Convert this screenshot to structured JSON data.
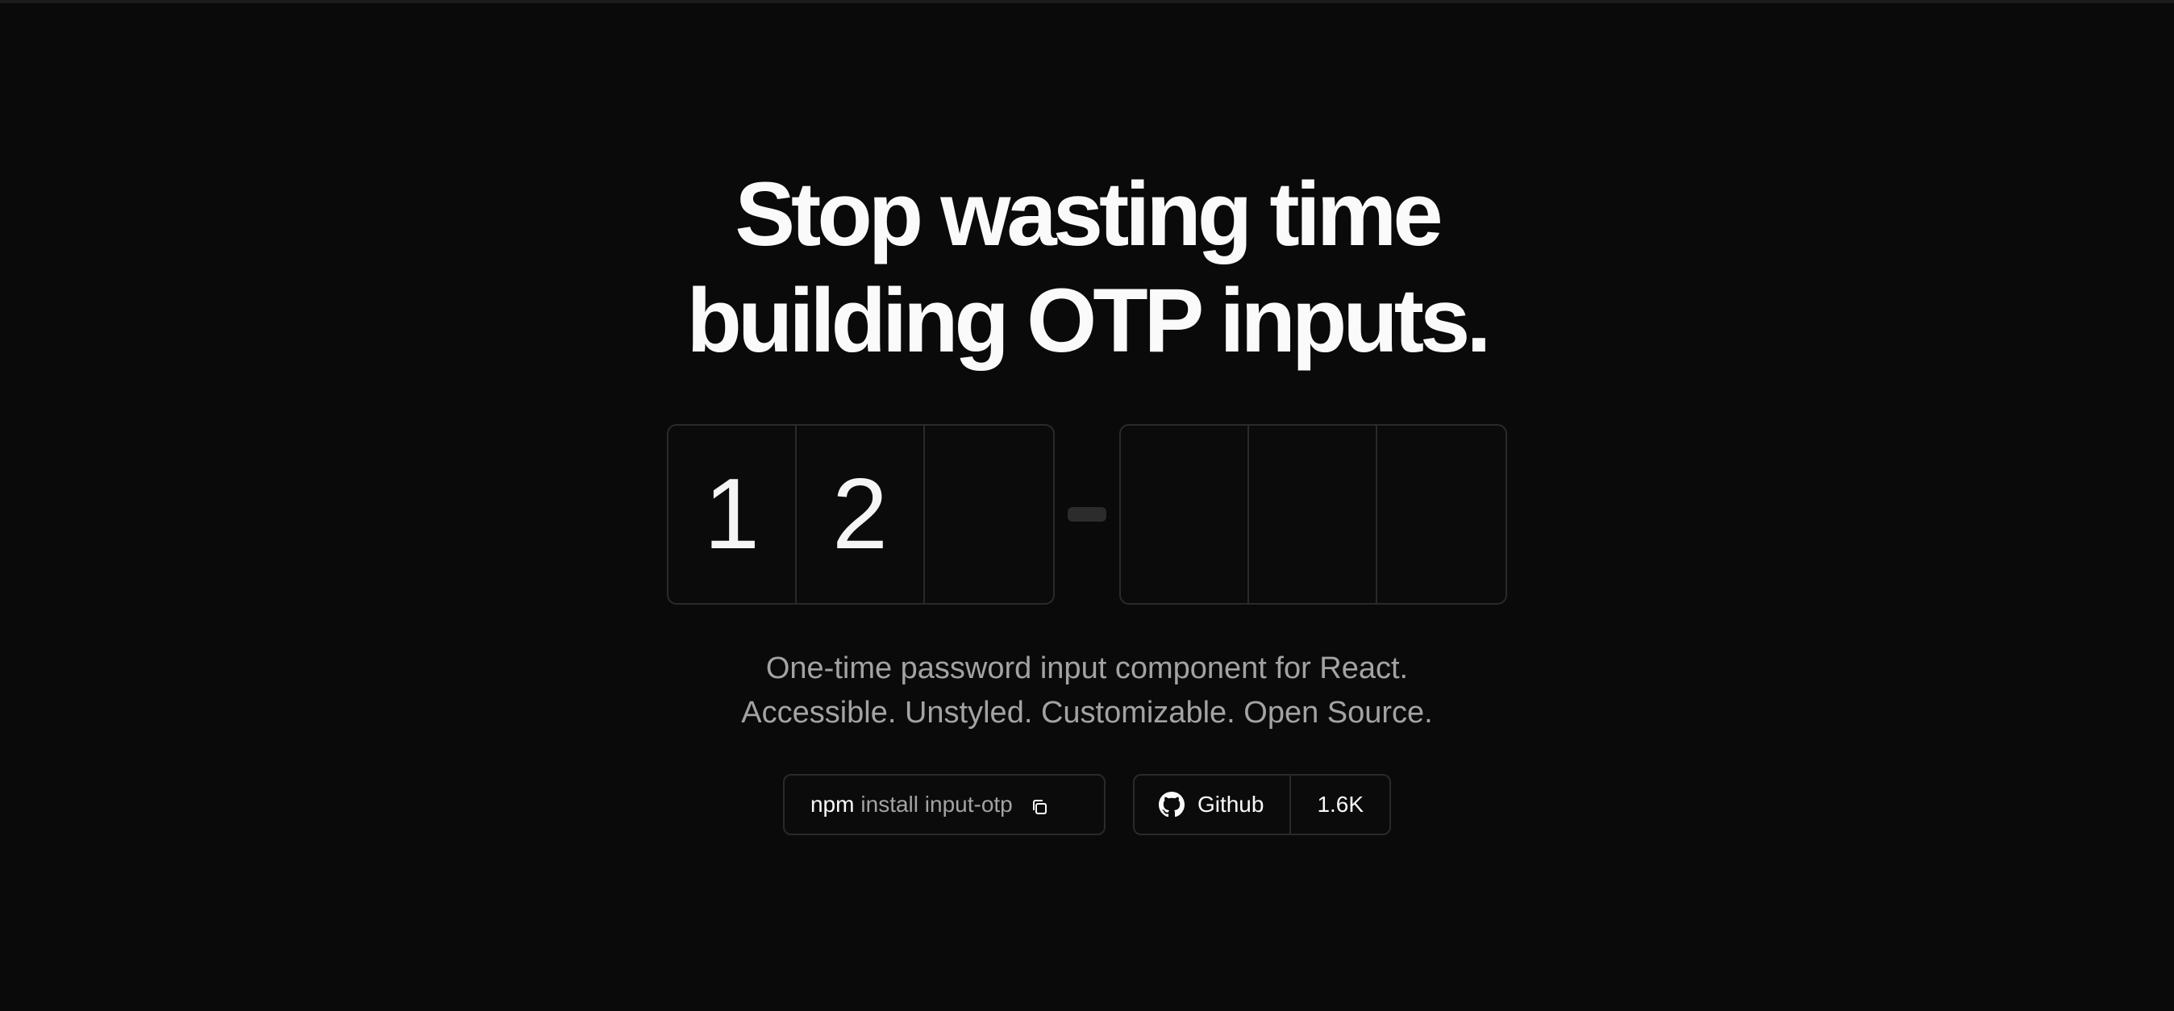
{
  "hero": {
    "headline_line1": "Stop wasting time",
    "headline_line2": "building OTP inputs."
  },
  "otp": {
    "slots_group1": [
      "1",
      "2",
      ""
    ],
    "slots_group2": [
      "",
      "",
      ""
    ]
  },
  "tagline": {
    "line1": "One-time password input component for React.",
    "line2": "Accessible. Unstyled. Customizable. Open Source."
  },
  "install": {
    "command": "npm",
    "args": "install input-otp",
    "copy_icon": "copy-icon"
  },
  "github": {
    "label": "Github",
    "icon": "github-icon",
    "stars": "1.6K"
  },
  "colors": {
    "background": "#0a0a0a",
    "text_primary": "#fafafa",
    "text_muted": "#a3a3a3",
    "border": "#2a2a2a"
  }
}
